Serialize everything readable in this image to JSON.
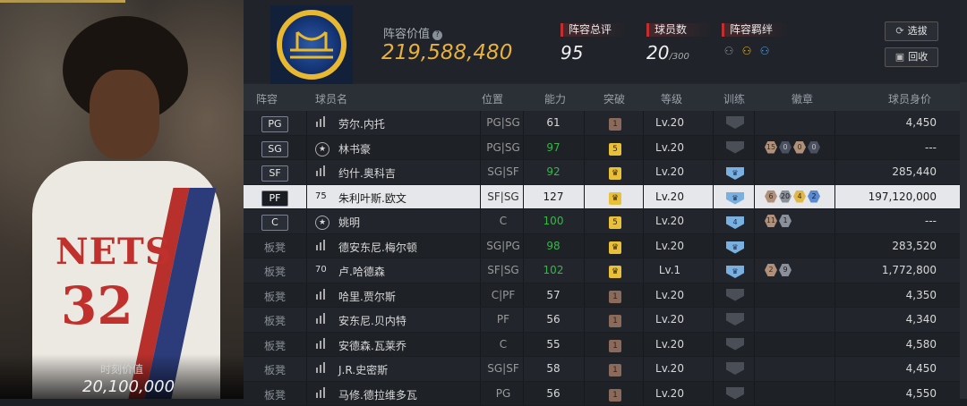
{
  "player_card": {
    "moment_label": "时刻价值",
    "moment_value": "20,100,000",
    "jersey_text": "NETS",
    "jersey_number": "32"
  },
  "header": {
    "value_label": "阵容价值",
    "value_help": "?",
    "value": "219,588,480",
    "overall_label": "阵容总评",
    "overall_value": "95",
    "count_label": "球员数",
    "count_value": "20",
    "count_max": "/300",
    "chem_label": "阵容羁绊",
    "swap_button": "选拔",
    "recycle_button": "回收"
  },
  "table": {
    "columns": [
      "阵容",
      "球员名",
      "位置",
      "能力",
      "突破",
      "等级",
      "训练",
      "徽章",
      "球员身价"
    ],
    "rows": [
      {
        "pos": "PG",
        "badge_pos": true,
        "icon": "stats",
        "name": "劳尔.内托",
        "slot": "PG|SG",
        "ovr": "61",
        "ovr_green": false,
        "brk": "1",
        "brk_type": "r",
        "lv": "Lv.20",
        "train": "",
        "train_type": "g",
        "badges": [],
        "salary": "4,450"
      },
      {
        "pos": "SG",
        "badge_pos": true,
        "icon": "star",
        "name": "林书豪",
        "slot": "PG|SG",
        "ovr": "97",
        "ovr_green": true,
        "brk": "5",
        "brk_type": "y",
        "lv": "Lv.20",
        "train": "",
        "train_type": "g",
        "badges": [
          {
            "v": "15",
            "t": "bronze"
          },
          {
            "v": "0",
            "t": "dark"
          },
          {
            "v": "0",
            "t": "bronze"
          },
          {
            "v": "0",
            "t": "dark"
          }
        ],
        "salary": "---"
      },
      {
        "pos": "SF",
        "badge_pos": true,
        "icon": "stats",
        "name": "约什.奥科吉",
        "slot": "SG|SF",
        "ovr": "92",
        "ovr_green": true,
        "brk": "♛",
        "brk_type": "y",
        "lv": "Lv.20",
        "train": "♛",
        "train_type": "b",
        "badges": [],
        "salary": "285,440"
      },
      {
        "pos": "PF",
        "badge_pos": true,
        "icon": "75",
        "name": "朱利叶斯.欧文",
        "slot": "SF|SG",
        "ovr": "127",
        "ovr_green": false,
        "brk": "♛",
        "brk_type": "y",
        "lv": "Lv.20",
        "train": "♛",
        "train_type": "b",
        "badges": [
          {
            "v": "6",
            "t": "bronze"
          },
          {
            "v": "20",
            "t": "silver"
          },
          {
            "v": "4",
            "t": "gold"
          },
          {
            "v": "2",
            "t": "blue"
          }
        ],
        "salary": "197,120,000",
        "selected": true
      },
      {
        "pos": "C",
        "badge_pos": true,
        "icon": "star",
        "name": "姚明",
        "slot": "C",
        "ovr": "100",
        "ovr_green": true,
        "brk": "5",
        "brk_type": "y",
        "lv": "Lv.20",
        "train": "4",
        "train_type": "b",
        "badges": [
          {
            "v": "11",
            "t": "bronze"
          },
          {
            "v": "1",
            "t": "silver"
          }
        ],
        "salary": "---"
      },
      {
        "pos": "板凳",
        "badge_pos": false,
        "icon": "stats",
        "name": "德安东尼.梅尔顿",
        "slot": "SG|PG",
        "ovr": "98",
        "ovr_green": true,
        "brk": "♛",
        "brk_type": "y",
        "lv": "Lv.20",
        "train": "♛",
        "train_type": "b",
        "badges": [],
        "salary": "283,520"
      },
      {
        "pos": "板凳",
        "badge_pos": false,
        "icon": "70",
        "name": "卢.哈德森",
        "slot": "SF|SG",
        "ovr": "102",
        "ovr_green": true,
        "brk": "♛",
        "brk_type": "y",
        "lv": "Lv.1",
        "train": "♛",
        "train_type": "b",
        "badges": [
          {
            "v": "2",
            "t": "bronze"
          },
          {
            "v": "9",
            "t": "silver"
          }
        ],
        "salary": "1,772,800"
      },
      {
        "pos": "板凳",
        "badge_pos": false,
        "icon": "stats",
        "name": "哈里.贾尔斯",
        "slot": "C|PF",
        "ovr": "57",
        "ovr_green": false,
        "brk": "1",
        "brk_type": "r",
        "lv": "Lv.20",
        "train": "",
        "train_type": "g",
        "badges": [],
        "salary": "4,350"
      },
      {
        "pos": "板凳",
        "badge_pos": false,
        "icon": "stats",
        "name": "安东尼.贝内特",
        "slot": "PF",
        "ovr": "56",
        "ovr_green": false,
        "brk": "1",
        "brk_type": "r",
        "lv": "Lv.20",
        "train": "",
        "train_type": "g",
        "badges": [],
        "salary": "4,340"
      },
      {
        "pos": "板凳",
        "badge_pos": false,
        "icon": "stats",
        "name": "安德森.瓦莱乔",
        "slot": "C",
        "ovr": "55",
        "ovr_green": false,
        "brk": "1",
        "brk_type": "r",
        "lv": "Lv.20",
        "train": "",
        "train_type": "g",
        "badges": [],
        "salary": "4,580"
      },
      {
        "pos": "板凳",
        "badge_pos": false,
        "icon": "stats",
        "name": "J.R.史密斯",
        "slot": "SG|SF",
        "ovr": "58",
        "ovr_green": false,
        "brk": "1",
        "brk_type": "r",
        "lv": "Lv.20",
        "train": "",
        "train_type": "g",
        "badges": [],
        "salary": "4,450"
      },
      {
        "pos": "板凳",
        "badge_pos": false,
        "icon": "stats",
        "name": "马修.德拉维多瓦",
        "slot": "PG",
        "ovr": "56",
        "ovr_green": false,
        "brk": "1",
        "brk_type": "r",
        "lv": "Lv.20",
        "train": "",
        "train_type": "g",
        "badges": [],
        "salary": "4,550"
      }
    ]
  }
}
